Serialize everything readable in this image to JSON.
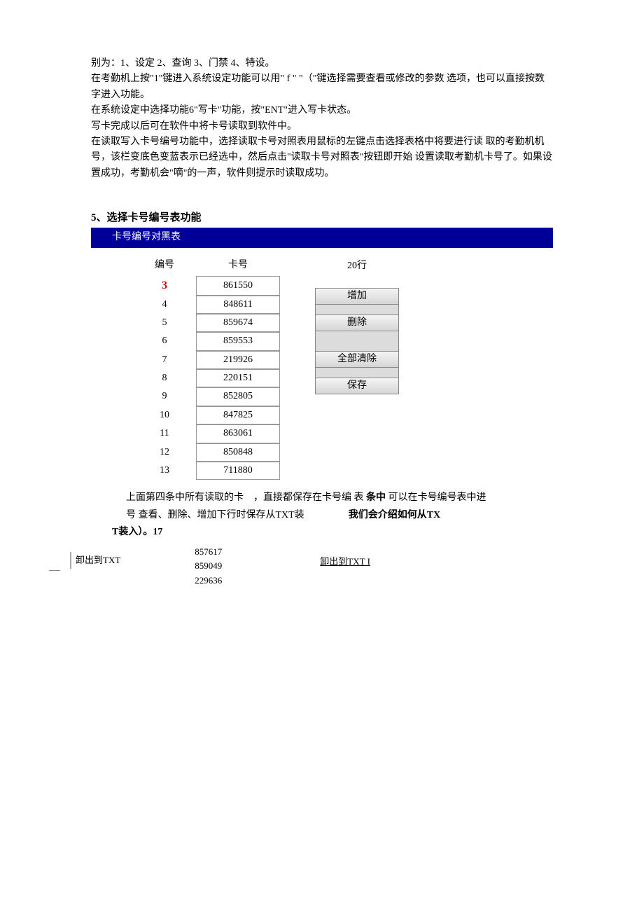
{
  "intro": {
    "line1": "别为：1、设定 2、查询 3、门禁 4、特设。",
    "line2": "在考勤机上按\"1\"键进入系统设定功能可以用\" f \"  \"（\"键选择需要查看或修改的参数 选项，也可以直接按数字进入功能。",
    "line3": "在系统设定中选择功能6\"写卡\"功能，按\"ENT\"进入写卡状态。",
    "line4": "写卡完成以后可在软件中将卡号读取到软件中。",
    "line5": "在读取写入卡号编号功能中，选择读取卡号对照表用鼠标的左键点击选择表格中将要进行读 取的考勤机机号，该栏变底色变蓝表示已经选中，然后点击\"读取卡号对照表\"按钮即开始 设置读取考勤机卡号了。如果设置成功，考勤机会\"嘀\"的一声，软件则提示时读取成功。"
  },
  "section": {
    "title": "5、选择卡号编号表功能",
    "bar_title": "卡号编号对黑表"
  },
  "table": {
    "header_num": "编号",
    "header_card": "卡号",
    "rows": [
      {
        "num": "3",
        "card": "861550",
        "highlight": true
      },
      {
        "num": "4",
        "card": "848611"
      },
      {
        "num": "5",
        "card": "859674"
      },
      {
        "num": "6",
        "card": "859553"
      },
      {
        "num": "7",
        "card": "219926"
      },
      {
        "num": "8",
        "card": "220151"
      },
      {
        "num": "9",
        "card": "852805"
      },
      {
        "num": "10",
        "card": "847825"
      },
      {
        "num": "11",
        "card": "863061"
      },
      {
        "num": "12",
        "card": "850848"
      },
      {
        "num": "13",
        "card": "711880"
      }
    ]
  },
  "controls": {
    "row_count": "20行",
    "btn_add": "增加",
    "btn_delete": "删除",
    "btn_clear_all": "全部清除",
    "btn_save": "保存"
  },
  "bottom": {
    "seg1a": "上面第四条中所有读取的卡",
    "seg1b": "，直接都保存在卡号编  表",
    "seg1c": "条中",
    "seg1d": "可以在卡号编号表中进",
    "seg2a": "号 查看、删除、增加下行时保存从TXT装",
    "seg2b": "我们会介绍如何从TX",
    "seg3": "T装入）。17"
  },
  "extra": {
    "export_btn": "卸出到TXT",
    "nums": [
      "857617",
      "859049",
      "229636"
    ],
    "export_link": "卸出到TXT I"
  }
}
